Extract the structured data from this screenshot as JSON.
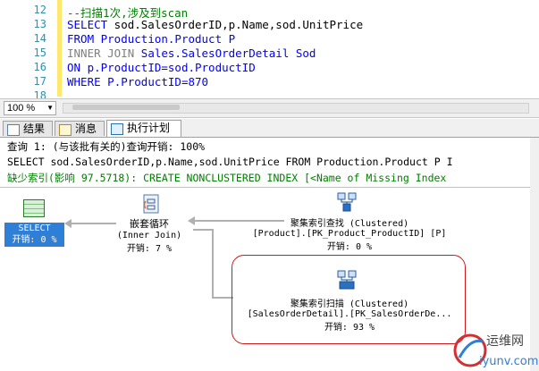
{
  "editor": {
    "lines": [
      {
        "num": "12",
        "text": "--扫描1次,涉及到scan"
      },
      {
        "num": "13",
        "kw": "SELECT",
        "text": " sod.SalesOrderID,p.Name,sod.UnitPrice"
      },
      {
        "num": "14",
        "kw": "FROM",
        "text": " Production.Product P"
      },
      {
        "num": "15",
        "kw": "INNER JOIN",
        "text": " Sales.SalesOrderDetail Sod"
      },
      {
        "num": "16",
        "kw": "ON",
        "text": " p.ProductID=sod.ProductID"
      },
      {
        "num": "17",
        "kw": "WHERE",
        "text": " P.ProductID=870"
      },
      {
        "num": "18",
        "text": ""
      }
    ]
  },
  "zoom": {
    "value": "100 %"
  },
  "tabs": [
    {
      "label": "结果"
    },
    {
      "label": "消息"
    },
    {
      "label": "执行计划"
    }
  ],
  "plan": {
    "header": "查询 1: (与该批有关的)查询开销: 100%",
    "sql": "SELECT sod.SalesOrderID,p.Name,sod.UnitPrice FROM Production.Product P I",
    "missing_index": "缺少索引(影响 97.5718): CREATE NONCLUSTERED INDEX [<Name of Missing Index",
    "select_node": {
      "name": "SELECT",
      "cost": "开销: 0 %"
    },
    "nested_loops": {
      "name": "嵌套循环",
      "sub": "(Inner Join)",
      "cost": "开销: 7 %"
    },
    "seek": {
      "name": "聚集索引查找 (Clustered)",
      "object": "[Product].[PK_Product_ProductID] [P]",
      "cost": "开销: 0 %"
    },
    "scan": {
      "name": "聚集索引扫描 (Clustered)",
      "object": "[SalesOrderDetail].[PK_SalesOrderDe...",
      "cost": "开销: 93 %"
    }
  },
  "watermark": {
    "site": "运维网",
    "url": "iyunv.com"
  },
  "colors": {
    "keyword": "#0000ff",
    "comment": "#008000",
    "selection": "#2f7fd7",
    "highlight": "#d01818"
  }
}
